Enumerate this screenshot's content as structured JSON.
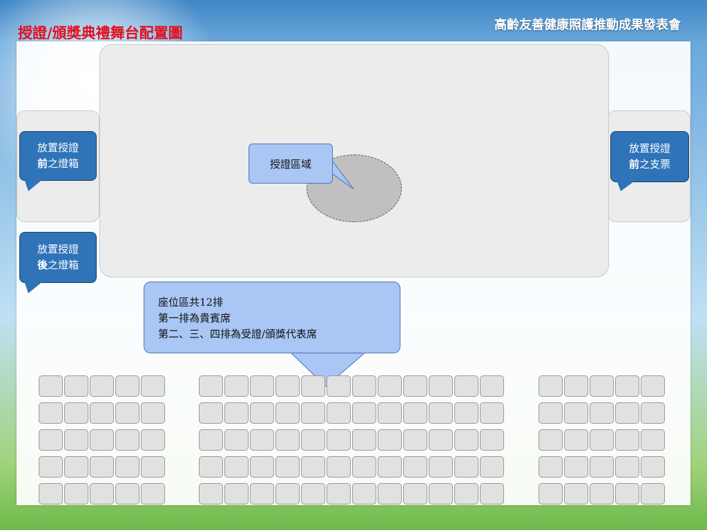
{
  "header": {
    "title": "授證/頒獎典禮舞台配置圖",
    "event_title": "高齡友善健康照護推動成果發表會"
  },
  "callouts": {
    "left_before": {
      "line1": "放置授證",
      "line2_bold": "前",
      "line2_rest": "之燈箱"
    },
    "right_before": {
      "line1": "放置授證",
      "line2_bold": "前",
      "line2_rest": "之支票"
    },
    "left_after": {
      "line1": "放置授證",
      "line2_bold": "後",
      "line2_rest": "之燈箱"
    }
  },
  "stage": {
    "certificate_area_label": "授證區域"
  },
  "seating": {
    "note_lines": [
      "座位區共12排",
      "第一排為貴賓席",
      "第二、三、四排為受證/頒獎代表席"
    ],
    "blocks": [
      {
        "name": "left",
        "rows": 5,
        "cols": 5
      },
      {
        "name": "center",
        "rows": 5,
        "cols": 12
      },
      {
        "name": "right",
        "rows": 5,
        "cols": 5
      }
    ]
  },
  "colors": {
    "title_red": "#e01020",
    "callout_dark_blue": "#2f73b8",
    "callout_light_blue": "#a9c6f5",
    "seat_gray": "#e1e1e1"
  }
}
